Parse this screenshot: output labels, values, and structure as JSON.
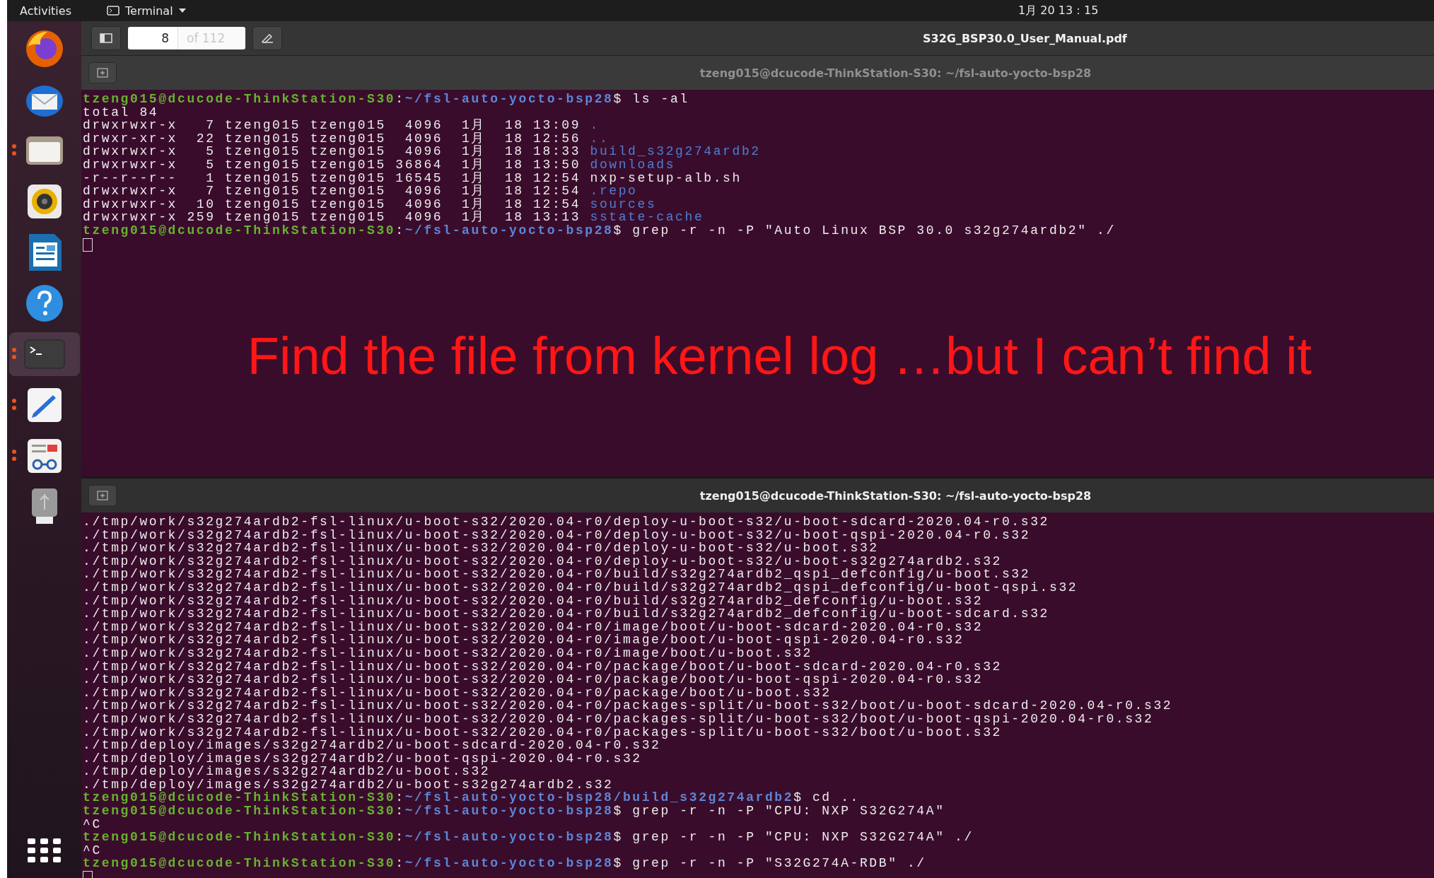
{
  "top_bar": {
    "activities": "Activities",
    "app_menu": "Terminal",
    "clock": "1月 20 13：15"
  },
  "dock": {
    "items": [
      {
        "kind": "firefox",
        "running": false,
        "selected": false
      },
      {
        "kind": "mail",
        "running": false,
        "selected": false
      },
      {
        "kind": "files",
        "running": true,
        "selected": false
      },
      {
        "kind": "speaker",
        "running": false,
        "selected": false
      },
      {
        "kind": "writer",
        "running": false,
        "selected": false
      },
      {
        "kind": "help",
        "running": false,
        "selected": false
      },
      {
        "kind": "terminal",
        "running": true,
        "selected": true
      },
      {
        "kind": "editor",
        "running": true,
        "selected": false
      },
      {
        "kind": "viewer",
        "running": true,
        "selected": false
      },
      {
        "kind": "usb",
        "running": false,
        "selected": false
      }
    ]
  },
  "pdf_viewer": {
    "page": "8",
    "page_count": "of 112",
    "title": "S32G_BSP30.0_User_Manual.pdf"
  },
  "terminals": [
    {
      "title": "tzeng015@dcucode-ThinkStation-S30: ~/fsl-auto-yocto-bsp28",
      "focused": false,
      "cursor": true,
      "annotation": "Find the file from kernel log …but I can’t find it",
      "lines": [
        [
          {
            "kind": "user",
            "text": "tzeng015@dcucode-ThinkStation-S30"
          },
          {
            "kind": "plain",
            "text": ":"
          },
          {
            "kind": "path",
            "text": "~/fsl-auto-yocto-bsp28"
          },
          {
            "kind": "plain",
            "text": "$ ls -al"
          }
        ],
        [
          {
            "kind": "plain",
            "text": "total 84"
          }
        ],
        [
          {
            "kind": "plain",
            "text": "drwxrwxr-x   7 tzeng015 tzeng015  4096  1月  18 13:09 "
          },
          {
            "kind": "dir",
            "text": "."
          }
        ],
        [
          {
            "kind": "plain",
            "text": "drwxr-xr-x  22 tzeng015 tzeng015  4096  1月  18 12:56 "
          },
          {
            "kind": "dir",
            "text": ".."
          }
        ],
        [
          {
            "kind": "plain",
            "text": "drwxrwxr-x   5 tzeng015 tzeng015  4096  1月  18 18:33 "
          },
          {
            "kind": "dir",
            "text": "build_s32g274ardb2"
          }
        ],
        [
          {
            "kind": "plain",
            "text": "drwxrwxr-x   5 tzeng015 tzeng015 36864  1月  18 13:50 "
          },
          {
            "kind": "dir",
            "text": "downloads"
          }
        ],
        [
          {
            "kind": "plain",
            "text": "-r--r--r--   1 tzeng015 tzeng015 16545  1月  18 12:54 nxp-setup-alb.sh"
          }
        ],
        [
          {
            "kind": "plain",
            "text": "drwxrwxr-x   7 tzeng015 tzeng015  4096  1月  18 12:54 "
          },
          {
            "kind": "dir",
            "text": ".repo"
          }
        ],
        [
          {
            "kind": "plain",
            "text": "drwxrwxr-x  10 tzeng015 tzeng015  4096  1月  18 12:54 "
          },
          {
            "kind": "dir",
            "text": "sources"
          }
        ],
        [
          {
            "kind": "plain",
            "text": "drwxrwxr-x 259 tzeng015 tzeng015  4096  1月  18 13:13 "
          },
          {
            "kind": "dir",
            "text": "sstate-cache"
          }
        ],
        [
          {
            "kind": "user",
            "text": "tzeng015@dcucode-ThinkStation-S30"
          },
          {
            "kind": "plain",
            "text": ":"
          },
          {
            "kind": "path",
            "text": "~/fsl-auto-yocto-bsp28"
          },
          {
            "kind": "plain",
            "text": "$ grep -r -n -P \"Auto Linux BSP 30.0 s32g274ardb2\" ./"
          }
        ]
      ]
    },
    {
      "title": "tzeng015@dcucode-ThinkStation-S30: ~/fsl-auto-yocto-bsp28",
      "focused": true,
      "cursor": true,
      "lines": [
        [
          {
            "kind": "plain",
            "text": "./tmp/work/s32g274ardb2-fsl-linux/u-boot-s32/2020.04-r0/deploy-u-boot-s32/u-boot-sdcard-2020.04-r0.s32"
          }
        ],
        [
          {
            "kind": "plain",
            "text": "./tmp/work/s32g274ardb2-fsl-linux/u-boot-s32/2020.04-r0/deploy-u-boot-s32/u-boot-qspi-2020.04-r0.s32"
          }
        ],
        [
          {
            "kind": "plain",
            "text": "./tmp/work/s32g274ardb2-fsl-linux/u-boot-s32/2020.04-r0/deploy-u-boot-s32/u-boot.s32"
          }
        ],
        [
          {
            "kind": "plain",
            "text": "./tmp/work/s32g274ardb2-fsl-linux/u-boot-s32/2020.04-r0/deploy-u-boot-s32/u-boot-s32g274ardb2.s32"
          }
        ],
        [
          {
            "kind": "plain",
            "text": "./tmp/work/s32g274ardb2-fsl-linux/u-boot-s32/2020.04-r0/build/s32g274ardb2_qspi_defconfig/u-boot.s32"
          }
        ],
        [
          {
            "kind": "plain",
            "text": "./tmp/work/s32g274ardb2-fsl-linux/u-boot-s32/2020.04-r0/build/s32g274ardb2_qspi_defconfig/u-boot-qspi.s32"
          }
        ],
        [
          {
            "kind": "plain",
            "text": "./tmp/work/s32g274ardb2-fsl-linux/u-boot-s32/2020.04-r0/build/s32g274ardb2_defconfig/u-boot.s32"
          }
        ],
        [
          {
            "kind": "plain",
            "text": "./tmp/work/s32g274ardb2-fsl-linux/u-boot-s32/2020.04-r0/build/s32g274ardb2_defconfig/u-boot-sdcard.s32"
          }
        ],
        [
          {
            "kind": "plain",
            "text": "./tmp/work/s32g274ardb2-fsl-linux/u-boot-s32/2020.04-r0/image/boot/u-boot-sdcard-2020.04-r0.s32"
          }
        ],
        [
          {
            "kind": "plain",
            "text": "./tmp/work/s32g274ardb2-fsl-linux/u-boot-s32/2020.04-r0/image/boot/u-boot-qspi-2020.04-r0.s32"
          }
        ],
        [
          {
            "kind": "plain",
            "text": "./tmp/work/s32g274ardb2-fsl-linux/u-boot-s32/2020.04-r0/image/boot/u-boot.s32"
          }
        ],
        [
          {
            "kind": "plain",
            "text": "./tmp/work/s32g274ardb2-fsl-linux/u-boot-s32/2020.04-r0/package/boot/u-boot-sdcard-2020.04-r0.s32"
          }
        ],
        [
          {
            "kind": "plain",
            "text": "./tmp/work/s32g274ardb2-fsl-linux/u-boot-s32/2020.04-r0/package/boot/u-boot-qspi-2020.04-r0.s32"
          }
        ],
        [
          {
            "kind": "plain",
            "text": "./tmp/work/s32g274ardb2-fsl-linux/u-boot-s32/2020.04-r0/package/boot/u-boot.s32"
          }
        ],
        [
          {
            "kind": "plain",
            "text": "./tmp/work/s32g274ardb2-fsl-linux/u-boot-s32/2020.04-r0/packages-split/u-boot-s32/boot/u-boot-sdcard-2020.04-r0.s32"
          }
        ],
        [
          {
            "kind": "plain",
            "text": "./tmp/work/s32g274ardb2-fsl-linux/u-boot-s32/2020.04-r0/packages-split/u-boot-s32/boot/u-boot-qspi-2020.04-r0.s32"
          }
        ],
        [
          {
            "kind": "plain",
            "text": "./tmp/work/s32g274ardb2-fsl-linux/u-boot-s32/2020.04-r0/packages-split/u-boot-s32/boot/u-boot.s32"
          }
        ],
        [
          {
            "kind": "plain",
            "text": "./tmp/deploy/images/s32g274ardb2/u-boot-sdcard-2020.04-r0.s32"
          }
        ],
        [
          {
            "kind": "plain",
            "text": "./tmp/deploy/images/s32g274ardb2/u-boot-qspi-2020.04-r0.s32"
          }
        ],
        [
          {
            "kind": "plain",
            "text": "./tmp/deploy/images/s32g274ardb2/u-boot.s32"
          }
        ],
        [
          {
            "kind": "plain",
            "text": "./tmp/deploy/images/s32g274ardb2/u-boot-s32g274ardb2.s32"
          }
        ],
        [
          {
            "kind": "user",
            "text": "tzeng015@dcucode-ThinkStation-S30"
          },
          {
            "kind": "plain",
            "text": ":"
          },
          {
            "kind": "path",
            "text": "~/fsl-auto-yocto-bsp28/build_s32g274ardb2"
          },
          {
            "kind": "plain",
            "text": "$ cd .."
          }
        ],
        [
          {
            "kind": "user",
            "text": "tzeng015@dcucode-ThinkStation-S30"
          },
          {
            "kind": "plain",
            "text": ":"
          },
          {
            "kind": "path",
            "text": "~/fsl-auto-yocto-bsp28"
          },
          {
            "kind": "plain",
            "text": "$ grep -r -n -P \"CPU: NXP S32G274A\""
          }
        ],
        [
          {
            "kind": "plain",
            "text": "^C"
          }
        ],
        [
          {
            "kind": "user",
            "text": "tzeng015@dcucode-ThinkStation-S30"
          },
          {
            "kind": "plain",
            "text": ":"
          },
          {
            "kind": "path",
            "text": "~/fsl-auto-yocto-bsp28"
          },
          {
            "kind": "plain",
            "text": "$ grep -r -n -P \"CPU: NXP S32G274A\" ./"
          }
        ],
        [
          {
            "kind": "plain",
            "text": "^C"
          }
        ],
        [
          {
            "kind": "user",
            "text": "tzeng015@dcucode-ThinkStation-S30"
          },
          {
            "kind": "plain",
            "text": ":"
          },
          {
            "kind": "path",
            "text": "~/fsl-auto-yocto-bsp28"
          },
          {
            "kind": "plain",
            "text": "$ grep -r -n -P \"S32G274A-RDB\" ./"
          }
        ]
      ]
    }
  ]
}
